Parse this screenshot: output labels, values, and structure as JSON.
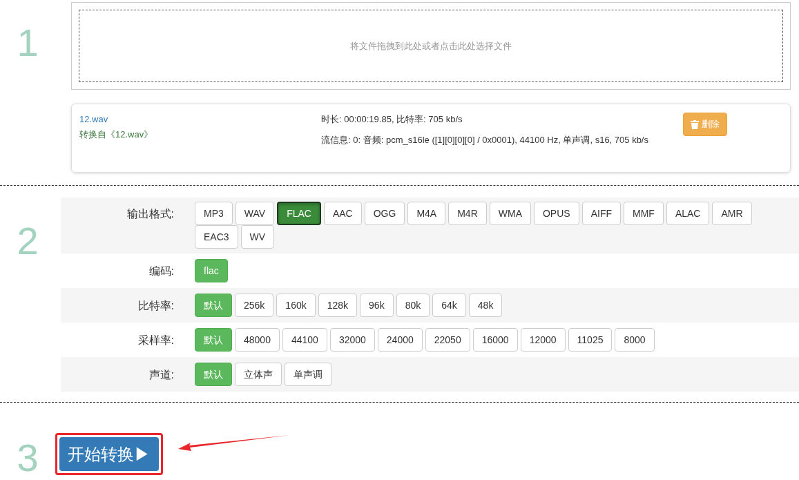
{
  "upload": {
    "step": "1",
    "hint": "将文件拖拽到此处或者点击此处选择文件"
  },
  "file": {
    "name": "12.wav",
    "source": "转换自《12.wav》",
    "duration": "时长: 00:00:19.85, 比特率: 705 kb/s",
    "stream": "流信息: 0: 音频: pcm_s16le ([1][0][0][0] / 0x0001), 44100 Hz, 单声调, s16, 705 kb/s",
    "delete_button": "删除"
  },
  "options": {
    "step": "2",
    "rows": [
      {
        "label": "输出格式:",
        "kind": "format",
        "choices": [
          {
            "label": "MP3",
            "selected": false
          },
          {
            "label": "WAV",
            "selected": false
          },
          {
            "label": "FLAC",
            "selected": true
          },
          {
            "label": "AAC",
            "selected": false
          },
          {
            "label": "OGG",
            "selected": false
          },
          {
            "label": "M4A",
            "selected": false
          },
          {
            "label": "M4R",
            "selected": false
          },
          {
            "label": "WMA",
            "selected": false
          },
          {
            "label": "OPUS",
            "selected": false
          },
          {
            "label": "AIFF",
            "selected": false
          },
          {
            "label": "MMF",
            "selected": false
          },
          {
            "label": "ALAC",
            "selected": false
          },
          {
            "label": "AMR",
            "selected": false
          },
          {
            "label": "EAC3",
            "selected": false
          },
          {
            "label": "WV",
            "selected": false
          }
        ]
      },
      {
        "label": "编码:",
        "kind": "option",
        "choices": [
          {
            "label": "flac",
            "selected": true
          }
        ]
      },
      {
        "label": "比特率:",
        "kind": "option",
        "choices": [
          {
            "label": "默认",
            "selected": true
          },
          {
            "label": "256k",
            "selected": false
          },
          {
            "label": "160k",
            "selected": false
          },
          {
            "label": "128k",
            "selected": false
          },
          {
            "label": "96k",
            "selected": false
          },
          {
            "label": "80k",
            "selected": false
          },
          {
            "label": "64k",
            "selected": false
          },
          {
            "label": "48k",
            "selected": false
          }
        ]
      },
      {
        "label": "采样率:",
        "kind": "option",
        "choices": [
          {
            "label": "默认",
            "selected": true
          },
          {
            "label": "48000",
            "selected": false
          },
          {
            "label": "44100",
            "selected": false
          },
          {
            "label": "32000",
            "selected": false
          },
          {
            "label": "24000",
            "selected": false
          },
          {
            "label": "22050",
            "selected": false
          },
          {
            "label": "16000",
            "selected": false
          },
          {
            "label": "12000",
            "selected": false
          },
          {
            "label": "11025",
            "selected": false
          },
          {
            "label": "8000",
            "selected": false
          }
        ]
      },
      {
        "label": "声道:",
        "kind": "option",
        "choices": [
          {
            "label": "默认",
            "selected": true
          },
          {
            "label": "立体声",
            "selected": false
          },
          {
            "label": "单声调",
            "selected": false
          }
        ]
      }
    ]
  },
  "start": {
    "step": "3",
    "button": "开始转换▶"
  }
}
